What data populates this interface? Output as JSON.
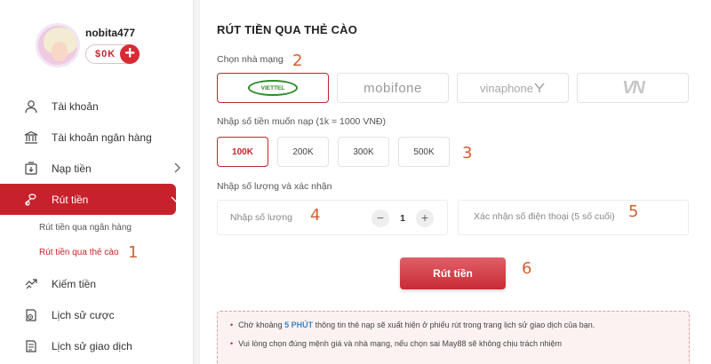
{
  "profile": {
    "username": "nobita477",
    "balance": "$0K",
    "add_icon": "plus-icon"
  },
  "menu": {
    "items": [
      {
        "label": "Tài khoản",
        "icon": "user-icon"
      },
      {
        "label": "Tài khoản ngân hàng",
        "icon": "bank-icon"
      },
      {
        "label": "Nạp tiền",
        "icon": "deposit-icon"
      },
      {
        "label": "Rút tiền",
        "icon": "withdraw-icon"
      },
      {
        "label": "Kiếm tiền",
        "icon": "handshake-icon"
      },
      {
        "label": "Lịch sử cược",
        "icon": "history-icon"
      },
      {
        "label": "Lịch sử giao dịch",
        "icon": "transaction-history-icon"
      }
    ],
    "submenu": [
      "Rút tiền qua ngân hàng",
      "Rút tiền qua thẻ cào"
    ]
  },
  "main": {
    "title": "RÚT TIỀN QUA THẺ CÀO",
    "network_label": "Chọn nhà mạng",
    "networks": [
      "VIETTEL",
      "mobifone",
      "vinaphone",
      "VN"
    ],
    "amount_label": "Nhập số tiền muốn nạp (1k = 1000 VNĐ)",
    "amounts": [
      "100K",
      "200K",
      "300K",
      "500K"
    ],
    "confirm_label": "Nhập số lượng và xác nhận",
    "quantity_placeholder": "Nhập số lượng",
    "quantity_value": "1",
    "minus": "−",
    "plus": "+",
    "phone_placeholder": "Xác nhận số điện thoại  (5 số cuối)",
    "submit_label": "Rút tiền",
    "notice": {
      "line1_pre": "Chờ khoảng ",
      "line1_highlight": "5 PHÚT",
      "line1_post": " thông tin thẻ nạp sẽ xuất hiện ở phiếu rút trong trang lịch sử giao dịch của bạn.",
      "line2": "Vui lòng chọn đúng mệnh giá và nhà mạng, nếu chọn sai May88 sẽ không chịu trách nhiệm"
    }
  },
  "annotations": [
    "1",
    "2",
    "3",
    "4",
    "5",
    "6"
  ],
  "colors": {
    "accent": "#c7222c",
    "highlight": "#3b87c9",
    "annotation": "#d06030"
  }
}
